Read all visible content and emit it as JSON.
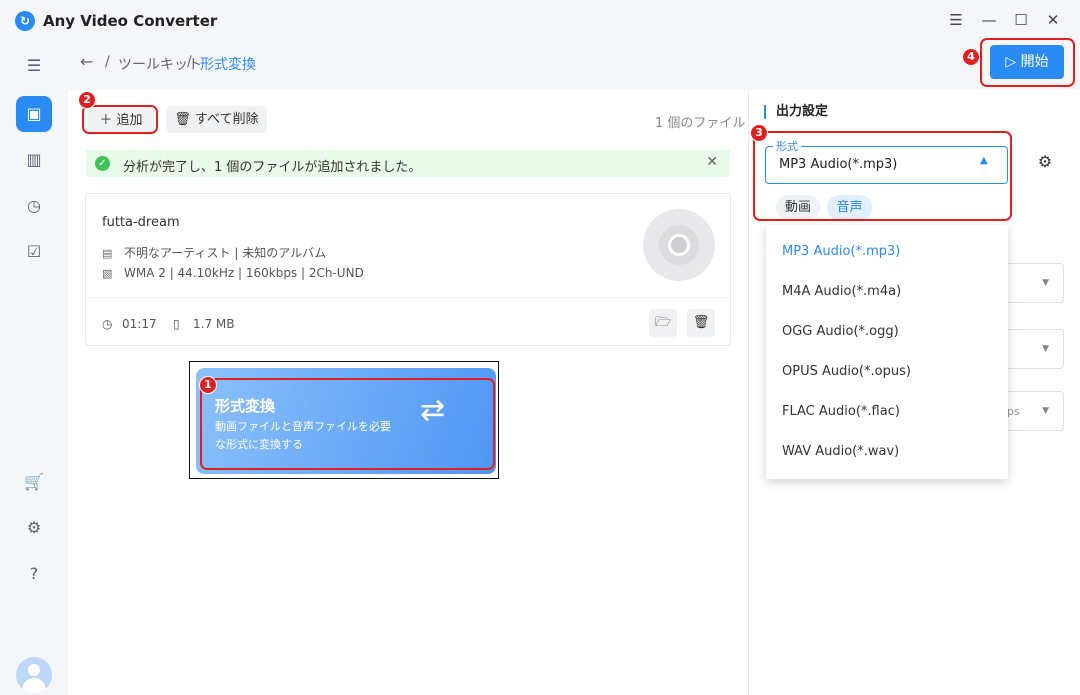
{
  "app": {
    "title": "Any Video Converter",
    "logo_icon": "app-logo-icon",
    "window_controls": [
      "☰",
      "—",
      "☐",
      "✕"
    ]
  },
  "breadcrumb": {
    "back": "←",
    "separator": "/",
    "toolkit": "ツールキット",
    "current": "形式変換"
  },
  "toolbar": {
    "add_label": "＋ 追加",
    "delete_all_label": "🗑 すべて削除",
    "file_count": "1 個のファイル",
    "start_label": "▷ 開始"
  },
  "notice": {
    "message": "分析が完了し、1 個のファイルが追加されました。",
    "close": "✕"
  },
  "file": {
    "name": "futta-dream",
    "artist_album": "不明なアーティスト | 未知のアルバム",
    "audio_info": "WMA 2 | 44.10kHz | 160kbps | 2Ch-UND",
    "duration": "01:17",
    "size": "1.7 MB"
  },
  "feature": {
    "title": "形式変換",
    "desc_line1": "動画ファイルと音声ファイルを必要",
    "desc_line2": "な形式に変換する"
  },
  "output": {
    "section_title": "出力設定",
    "format_label": "形式",
    "format_value": "MP3 Audio(*.mp3)",
    "tabs": [
      "動画",
      "音声"
    ],
    "active_tab": "音声",
    "options": [
      "MP3 Audio(*.mp3)",
      "M4A Audio(*.m4a)",
      "OGG Audio(*.ogg)",
      "OPUS Audio(*.opus)",
      "FLAC Audio(*.flac)",
      "WAV Audio(*.wav)"
    ],
    "partial_option_text": "ps"
  },
  "annotations": [
    "1",
    "2",
    "3",
    "4"
  ],
  "colors": {
    "accent": "#2b8bf5",
    "highlight": "#e02020",
    "success": "#3fc25a"
  }
}
